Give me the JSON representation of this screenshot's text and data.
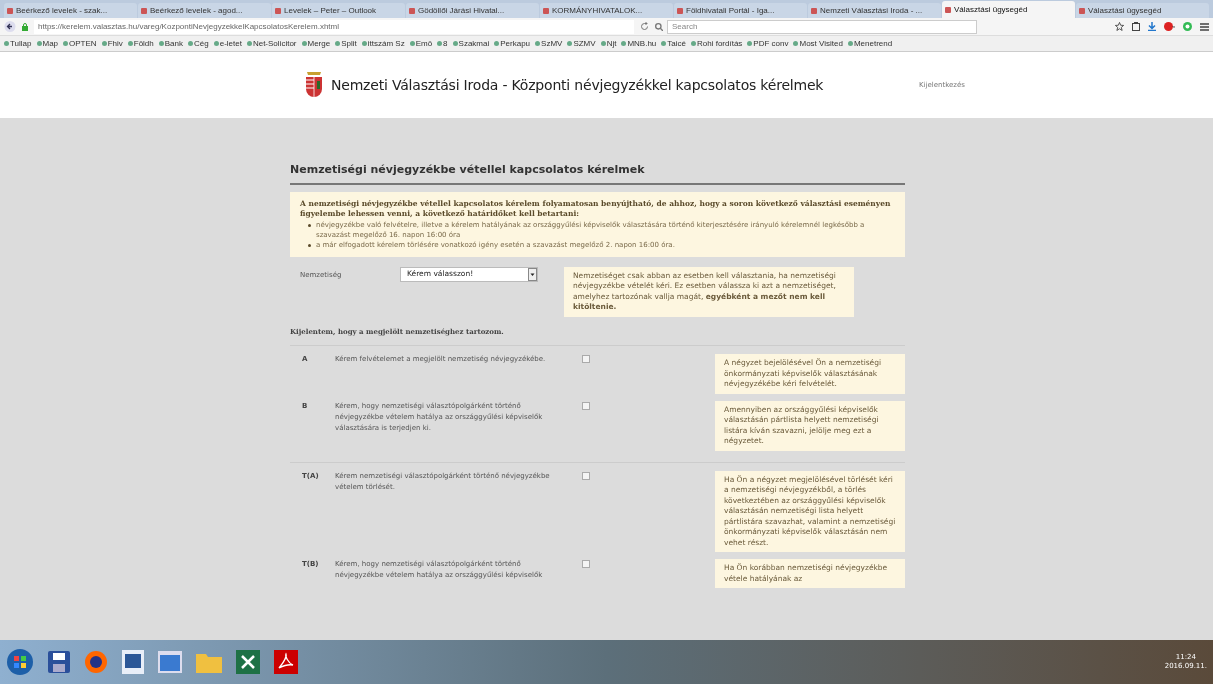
{
  "browser": {
    "tabs": [
      {
        "title": "Beérkező levelek - szak...",
        "selected": false
      },
      {
        "title": "Beérkező levelek - agod...",
        "selected": false
      },
      {
        "title": "Levelek – Peter – Outlook",
        "selected": false
      },
      {
        "title": "Gödöllői Járási Hivatal...",
        "selected": false
      },
      {
        "title": "KORMÁNYHIVATALOK...",
        "selected": false
      },
      {
        "title": "Földhivatali Portál - Iga...",
        "selected": false
      },
      {
        "title": "Nemzeti Választási Iroda - ...",
        "selected": false
      },
      {
        "title": "Választási ügysegéd",
        "selected": true
      },
      {
        "title": "Választási ügysegéd",
        "selected": false
      }
    ],
    "url": "https://kerelem.valasztas.hu/vareg/KozpontiNevjegyzekkelKapcsolatosKerelem.xhtml",
    "search": {
      "placeholder": "Search"
    },
    "bookmarks": [
      "Tullap",
      "Map",
      "OPTEN",
      "Fhiv",
      "Földh",
      "Bank",
      "Cég",
      "e-letet",
      "Net-Solicitor",
      "Merge",
      "Split",
      "ittszám Sz",
      "Emö",
      "8",
      "Szakmai",
      "Perkapu",
      "SzMV",
      "SZMV",
      "Njt",
      "MNB.hu",
      "Taicé",
      "Rohi fordítás",
      "PDF conv",
      "Most Visited",
      "Menetrend"
    ]
  },
  "header": {
    "title": "Nemzeti Választási Iroda - Központi névjegyzékkel kapcsolatos kérelmek",
    "logout": "Kijelentkezés"
  },
  "section_title": "Nemzetiségi névjegyzékbe vétellel kapcsolatos kérelmek",
  "notice": {
    "intro": "A nemzetiségi névjegyzékbe vétellel kapcsolatos kérelem folyamatosan benyújtható, de ahhoz, hogy a soron következő választási eseményen figyelembe lehessen venni, a következő határidőket kell betartani:",
    "bullets": [
      "névjegyzékbe való felvételre, illetve a kérelem hatályának az országgyűlési képviselők választására történő kiterjesztésére irányuló kérelemnél legkésőbb a szavazást megelőző 16. napon 16:00 óra",
      "a már elfogadott kérelem törlésére vonatkozó igény esetén a szavazást megelőző 2. napon 16:00 óra."
    ]
  },
  "nationality": {
    "label": "Nemzetiség",
    "value": "Kérem válasszon!",
    "hint": "Nemzetiséget csak abban az esetben kell választania, ha nemzetiségi névjegyzékbe vételét kéri. Ez esetben válassza ki azt a nemzetiséget, amelyhez tartozónak vallja magát, **egyébként a mezőt nem kell kitöltenie.**"
  },
  "declaration": "Kijelentem, hogy a megjelölt nemzetiséghez tartozom.",
  "groups": [
    [
      {
        "code": "A",
        "text": "Kérem felvételemet a megjelölt nemzetiség névjegyzékébe.",
        "checked": false,
        "note": "A négyzet bejelölésével Ön a nemzetiségi önkormányzati képviselők választásának névjegyzékébe kéri felvételét."
      },
      {
        "code": "B",
        "text": "Kérem, hogy nemzetiségi választópolgárként történő névjegyzékbe vételem hatálya az országgyűlési képviselők választására is terjedjen ki.",
        "checked": false,
        "note": "Amennyiben az országgyűlési képviselők választásán pártlista helyett nemzetiségi listára kíván szavazni, jelölje meg ezt a négyzetet."
      }
    ],
    [
      {
        "code": "T(A)",
        "text": "Kérem nemzetiségi választópolgárként történő névjegyzékbe vételem törlését.",
        "checked": false,
        "note": "Ha Ön a négyzet megjelölésével törlését kéri a nemzetiségi névjegyzékből, a törlés következtében az országgyűlési képviselők választásán nemzetiségi lista helyett pártlistára szavazhat, valamint a nemzetiségi önkormányzati képviselők választásán nem vehet részt."
      },
      {
        "code": "T(B)",
        "text": "Kérem, hogy nemzetiségi választópolgárként történő névjegyzékbe vételem hatálya az országgyűlési képviselők",
        "checked": false,
        "note": "Ha Ön korábban nemzetiségi névjegyzékbe vétele hatályának az"
      }
    ]
  ],
  "taskbar": {
    "time": "11:24",
    "date": "2016.09.11."
  }
}
